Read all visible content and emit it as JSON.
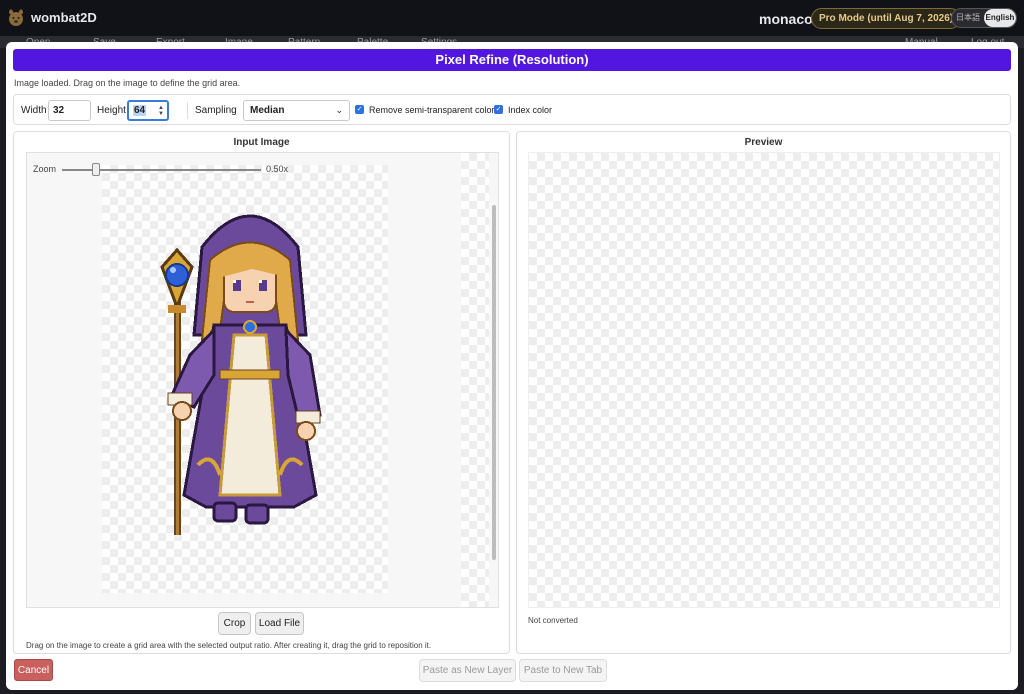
{
  "app": {
    "title": "wombat2D",
    "user": "monaco",
    "pro_badge": "Pro Mode (until Aug 7, 2026)",
    "lang_ja": "日本語",
    "lang_en": "English"
  },
  "menu": [
    "Open",
    "Save",
    "Export",
    "Image",
    "Pattern",
    "Palette",
    "Settings",
    "Manual",
    "Log out"
  ],
  "dialog": {
    "title": "Pixel Refine (Resolution)",
    "status": "Image loaded. Drag on the image to define the grid area.",
    "controls": {
      "width_label": "Width",
      "width_value": "32",
      "height_label": "Height",
      "height_value": "64",
      "sampling_label": "Sampling",
      "sampling_value": "Median",
      "remove_semi_label": "Remove semi-transparent colors",
      "remove_semi_checked": true,
      "index_color_label": "Index color",
      "index_color_checked": true
    },
    "input_panel": {
      "title": "Input Image",
      "zoom_label": "Zoom",
      "zoom_value": "0.50x",
      "zoom_level": 0.17,
      "crop_label": "Crop",
      "load_label": "Load File",
      "help": "Drag on the image to create a grid area with the selected output ratio. After creating it, drag the grid to reposition it."
    },
    "preview_panel": {
      "title": "Preview",
      "status": "Not converted"
    },
    "footer": {
      "cancel_label": "Cancel",
      "paste_layer_label": "Paste as New Layer",
      "paste_tab_label": "Paste to New Tab"
    }
  },
  "colors": {
    "accent": "#5316e0",
    "cancel": "#c9605e",
    "checkbox": "#2f6fe4",
    "robe_purple": "#6b4a9c",
    "hair_gold": "#e0a94a",
    "gem_blue": "#2e6fe0"
  },
  "image_subject": "pixel-art mage girl in purple hooded robe holding staff with blue gem"
}
